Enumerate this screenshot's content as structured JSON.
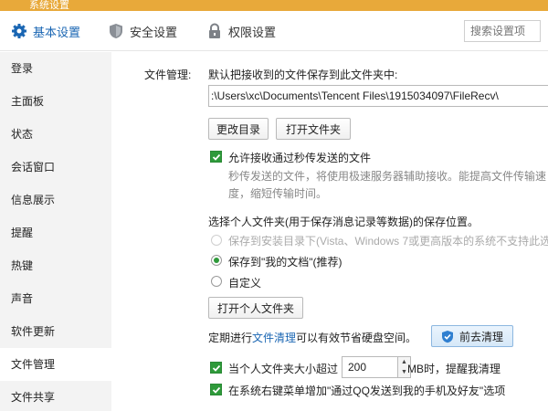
{
  "window": {
    "title": "系统设置"
  },
  "tabs": [
    {
      "label": "基本设置",
      "icon": "gear-icon",
      "active": true
    },
    {
      "label": "安全设置",
      "icon": "shield-icon",
      "active": false
    },
    {
      "label": "权限设置",
      "icon": "lock-icon",
      "active": false
    }
  ],
  "search": {
    "placeholder": "搜索设置项"
  },
  "sidebar": {
    "items": [
      {
        "label": "登录"
      },
      {
        "label": "主面板"
      },
      {
        "label": "状态"
      },
      {
        "label": "会话窗口"
      },
      {
        "label": "信息展示"
      },
      {
        "label": "提醒"
      },
      {
        "label": "热键"
      },
      {
        "label": "声音"
      },
      {
        "label": "软件更新"
      },
      {
        "label": "文件管理",
        "active": true
      },
      {
        "label": "文件共享"
      }
    ]
  },
  "file": {
    "section_label": "文件管理:",
    "default_desc": "默认把接收到的文件保存到此文件夹中:",
    "path": ":\\Users\\xc\\Documents\\Tencent Files\\1915034097\\FileRecv\\",
    "change_dir_btn": "更改目录",
    "open_folder_btn": "打开文件夹",
    "allow_fast_label": "允许接收通过秒传发送的文件",
    "allow_fast_desc_1": "秒传发送的文件，将使用极速服务器辅助接收。能提高文件传输速",
    "allow_fast_desc_2": "度，缩短传输时间。",
    "personal_folder_title": "选择个人文件夹(用于保存消息记录等数据)的保存位置。",
    "radio_install": "保存到安装目录下(Vista、Windows 7或更高版本的系统不支持此选项",
    "radio_mydocs": "保存到\"我的文档\"(推荐)",
    "radio_custom": "自定义",
    "open_personal_btn": "打开个人文件夹",
    "cleanup_prefix": "定期进行",
    "cleanup_link": "文件清理",
    "cleanup_suffix": "可以有效节省硬盘空间。",
    "cleanup_btn": "前去清理",
    "size_prefix": "当个人文件夹大小超过",
    "size_value": "200",
    "size_suffix": "MB时，提醒我清理",
    "context_menu_label": "在系统右键菜单增加\"通过QQ发送到我的手机及好友\"选项"
  },
  "colors": {
    "accent": "#1a66b3",
    "check": "#2e9a3a",
    "titlebar": "#e8a93a"
  }
}
